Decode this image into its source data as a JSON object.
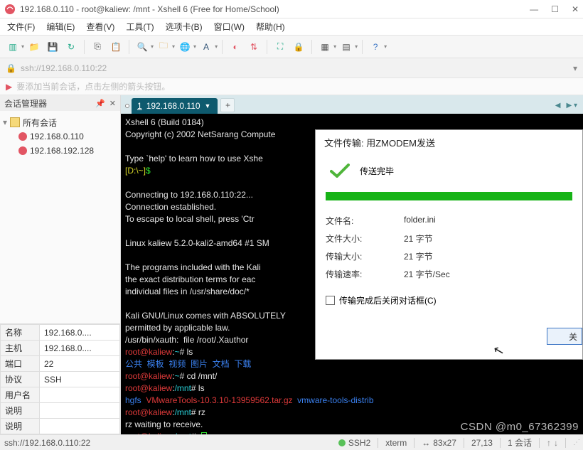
{
  "window": {
    "title": "192.168.0.110 - root@kaliew: /mnt - Xshell 6 (Free for Home/School)"
  },
  "menu": {
    "file": "文件(F)",
    "edit": "编辑(E)",
    "view": "查看(V)",
    "tools": "工具(T)",
    "tabs": "选项卡(B)",
    "window": "窗口(W)",
    "help": "帮助(H)"
  },
  "address": {
    "url": "ssh://192.168.0.110:22"
  },
  "hint": {
    "text": "要添加当前会话，点击左侧的箭头按钮。"
  },
  "sidebar": {
    "title": "会话管理器",
    "root": "所有会话",
    "items": [
      {
        "label": "192.168.0.110"
      },
      {
        "label": "192.168.192.128"
      }
    ]
  },
  "props": {
    "rows": [
      {
        "k": "名称",
        "v": "192.168.0...."
      },
      {
        "k": "主机",
        "v": "192.168.0...."
      },
      {
        "k": "端口",
        "v": "22"
      },
      {
        "k": "协议",
        "v": "SSH"
      },
      {
        "k": "用户名",
        "v": ""
      },
      {
        "k": "说明",
        "v": ""
      },
      {
        "k": "说明",
        "v": ""
      }
    ]
  },
  "tab": {
    "num": "1",
    "label": "192.168.0.110"
  },
  "term": {
    "l1": "Xshell 6 (Build 0184)",
    "l2": "Copyright (c) 2002 NetSarang Compute",
    "l3": "Type `help' to learn how to use Xshe",
    "l4a": "[D:\\~]",
    "l4b": "$",
    "l5": "Connecting to 192.168.0.110:22...",
    "l6": "Connection established.",
    "l7": "To escape to local shell, press 'Ctr",
    "l8": "Linux kaliew 5.2.0-kali2-amd64 #1 SM",
    "l9": "The programs included with the Kali ",
    "l10": "the exact distribution terms for eac",
    "l11": "individual files in /usr/share/doc/*",
    "l12": "Kali GNU/Linux comes with ABSOLUTELY",
    "l13": "permitted by applicable law.",
    "l14": "/usr/bin/xauth:  file /root/.Xauthor",
    "p_user": "root@kaliew",
    "p_sep": ":",
    "p_home": "~",
    "p_mnt": "/mnt",
    "p_hash": "#",
    "cmd_ls": " ls",
    "ls_out": "公共  模板  视频  图片  文档  下载",
    "cmd_cd": " cd /mnt/",
    "ls2a": "hgfs  ",
    "ls2b": "VMwareTools-10.3.10-13959562.tar.gz ",
    "ls2c": " vmware-tools-distrib",
    "cmd_rz": " rz",
    "rz_wait": "rz waiting to receive."
  },
  "dialog": {
    "title": "文件传输: 用ZMODEM发送",
    "done": "传送完毕",
    "rows": {
      "fname_k": "文件名:",
      "fname_v": "folder.ini",
      "fsize_k": "文件大小:",
      "fsize_v": "21 字节",
      "tsize_k": "传输大小:",
      "tsize_v": "21 字节",
      "rate_k": "传输速率:",
      "rate_v": "21 字节/Sec"
    },
    "close_after": "传输完成后关闭对话框(C)",
    "btn": "关"
  },
  "status": {
    "addr": "ssh://192.168.0.110:22",
    "s1": "SSH2",
    "s2": "xterm",
    "s3": "83x27",
    "s4": "27,13",
    "s5": "1 会话"
  },
  "watermark": "CSDN @m0_67362399"
}
